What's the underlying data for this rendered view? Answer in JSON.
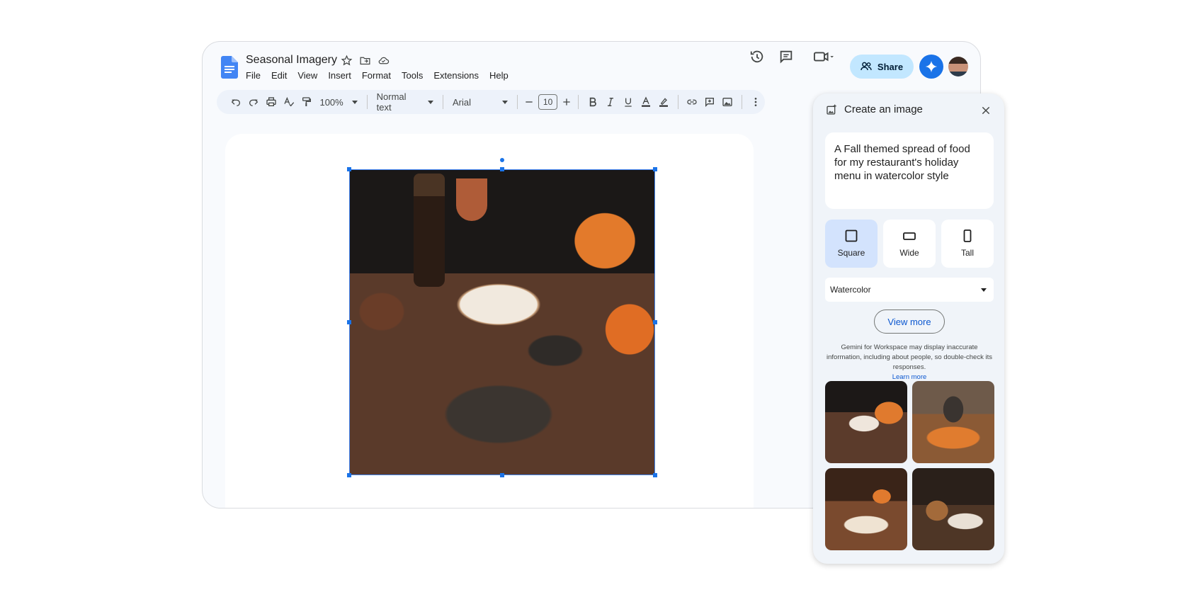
{
  "document": {
    "title": "Seasonal Imagery",
    "menu": [
      "File",
      "Edit",
      "View",
      "Insert",
      "Format",
      "Tools",
      "Extensions",
      "Help"
    ]
  },
  "header": {
    "share_label": "Share"
  },
  "toolbar": {
    "zoom": "100%",
    "paragraph_style": "Normal text",
    "font": "Arial",
    "font_size": "10"
  },
  "panel": {
    "title": "Create an image",
    "prompt": "A Fall themed spread of food for my restaurant's holiday menu in watercolor style",
    "ratios": [
      {
        "label": "Square",
        "selected": true
      },
      {
        "label": "Wide",
        "selected": false
      },
      {
        "label": "Tall",
        "selected": false
      }
    ],
    "style": "Watercolor",
    "view_more_label": "View more",
    "disclaimer": "Gemini for Workspace may display inaccurate information, including about people, so double-check its responses.",
    "learn_more_label": "Learn more"
  },
  "colors": {
    "accent": "#1a73e8",
    "share_bg": "#c2e7ff",
    "selected_ratio_bg": "#d3e3fd"
  }
}
